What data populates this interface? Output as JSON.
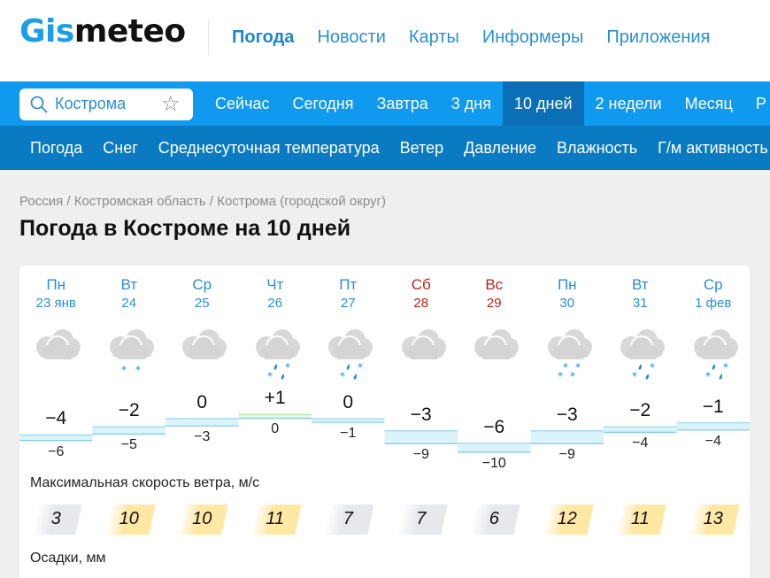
{
  "header": {
    "logo": {
      "part1": "Gis",
      "part2": "meteo"
    },
    "nav": [
      {
        "label": "Погода",
        "active": true
      },
      {
        "label": "Новости",
        "active": false
      },
      {
        "label": "Карты",
        "active": false
      },
      {
        "label": "Информеры",
        "active": false
      },
      {
        "label": "Приложения",
        "active": false
      }
    ]
  },
  "search": {
    "value": "Кострома",
    "icon": "search-icon",
    "favorite_icon": "star-icon"
  },
  "period_tabs": [
    {
      "label": "Сейчас",
      "active": false
    },
    {
      "label": "Сегодня",
      "active": false
    },
    {
      "label": "Завтра",
      "active": false
    },
    {
      "label": "3 дня",
      "active": false
    },
    {
      "label": "10 дней",
      "active": true
    },
    {
      "label": "2 недели",
      "active": false
    },
    {
      "label": "Месяц",
      "active": false
    },
    {
      "label": "Р",
      "active": false
    }
  ],
  "parameter_tabs": [
    "Погода",
    "Снег",
    "Среднесуточная температура",
    "Ветер",
    "Давление",
    "Влажность",
    "Г/м активность"
  ],
  "breadcrumbs": [
    "Россия",
    "Костромская область",
    "Кострома (городской округ)"
  ],
  "breadcrumb_separator": " / ",
  "page_title": "Погода в Костроме на 10 дней",
  "forecast": {
    "days": [
      {
        "dow": "Пн",
        "date": "23 янв",
        "weekend": false,
        "icon": "cloudy",
        "tmax": "−4",
        "tmin": "−6",
        "wind": "3",
        "wind_level": "calm"
      },
      {
        "dow": "Вт",
        "date": "24",
        "weekend": false,
        "icon": "cloudy-snow-light",
        "tmax": "−2",
        "tmin": "−5",
        "wind": "10",
        "wind_level": "moderate"
      },
      {
        "dow": "Ср",
        "date": "25",
        "weekend": false,
        "icon": "cloudy",
        "tmax": "0",
        "tmin": "−3",
        "wind": "10",
        "wind_level": "moderate"
      },
      {
        "dow": "Чт",
        "date": "26",
        "weekend": false,
        "icon": "cloudy-sleet",
        "tmax": "+1",
        "tmin": "0",
        "wind": "11",
        "wind_level": "moderate"
      },
      {
        "dow": "Пт",
        "date": "27",
        "weekend": false,
        "icon": "cloudy-sleet",
        "tmax": "0",
        "tmin": "−1",
        "wind": "7",
        "wind_level": "calm"
      },
      {
        "dow": "Сб",
        "date": "28",
        "weekend": true,
        "icon": "cloudy",
        "tmax": "−3",
        "tmin": "−9",
        "wind": "7",
        "wind_level": "calm"
      },
      {
        "dow": "Вс",
        "date": "29",
        "weekend": true,
        "icon": "cloudy",
        "tmax": "−6",
        "tmin": "−10",
        "wind": "6",
        "wind_level": "calm"
      },
      {
        "dow": "Пн",
        "date": "30",
        "weekend": false,
        "icon": "cloudy-snow",
        "tmax": "−3",
        "tmin": "−9",
        "wind": "12",
        "wind_level": "moderate"
      },
      {
        "dow": "Вт",
        "date": "31",
        "weekend": false,
        "icon": "cloudy-sleet",
        "tmax": "−2",
        "tmin": "−4",
        "wind": "11",
        "wind_level": "moderate"
      },
      {
        "dow": "Ср",
        "date": "1 фев",
        "weekend": false,
        "icon": "cloudy-sleet",
        "tmax": "−1",
        "tmin": "−4",
        "wind": "13",
        "wind_level": "moderate"
      }
    ],
    "temp_values": {
      "max": [
        -4,
        -2,
        0,
        1,
        0,
        -3,
        -6,
        -3,
        -2,
        -1
      ],
      "min": [
        -6,
        -5,
        -3,
        0,
        -1,
        -9,
        -10,
        -9,
        -4,
        -4
      ]
    },
    "wind_label": "Максимальная скорость ветра, м/с",
    "precip_label": "Осадки, мм"
  },
  "colors": {
    "brand_blue": "#1c9ee8",
    "nav_bar": "#0f9aef",
    "nav_bar_active": "#0a6fb7",
    "sub_bar": "#0a7bc2",
    "link": "#2a8fd3",
    "weekend": "#c0221a",
    "wind_calm": "#e6e8ec",
    "wind_moderate": "#ffe7a4"
  }
}
